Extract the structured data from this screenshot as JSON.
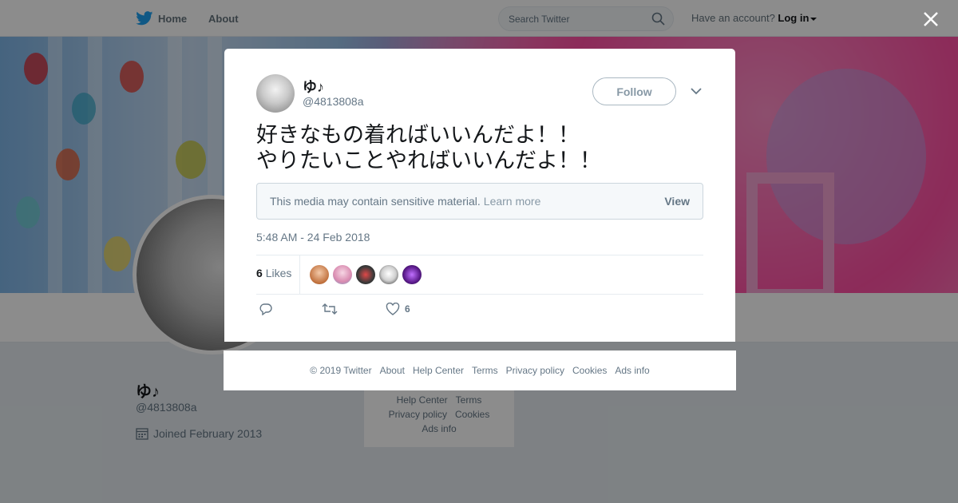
{
  "topbar": {
    "home_label": "Home",
    "about_label": "About",
    "search_placeholder": "Search Twitter",
    "account_prompt": "Have an account?",
    "login_label": "Log in"
  },
  "profile": {
    "name": "ゆ♪",
    "handle": "@4813808a",
    "joined": "Joined February 2013"
  },
  "side_footer": {
    "row1": [
      "Help Center",
      "Terms"
    ],
    "row2": [
      "Privacy policy",
      "Cookies"
    ],
    "row3": [
      "Ads info"
    ]
  },
  "tweet": {
    "author_name": "ゆ♪",
    "author_handle": "@4813808a",
    "follow_label": "Follow",
    "text_lines": [
      "好きなもの着ればいいんだよ！！",
      "やりたいことやればいいんだよ！！"
    ],
    "sensitive_message": "This media may contain sensitive material.",
    "learn_more_label": "Learn more",
    "view_label": "View",
    "timestamp": "5:48 AM - 24 Feb 2018",
    "likes_count": "6",
    "likes_label": "Likes",
    "like_action_count": "6"
  },
  "footer": {
    "copyright": "© 2019 Twitter",
    "links": [
      "About",
      "Help Center",
      "Terms",
      "Privacy policy",
      "Cookies",
      "Ads info"
    ]
  },
  "colors": {
    "twitter_blue": "#1da1f2",
    "text_secondary": "#657786",
    "border": "#e6ecf0"
  },
  "icons": [
    "twitter-bird-icon",
    "search-icon",
    "close-icon",
    "chevron-down-icon",
    "reply-icon",
    "retweet-icon",
    "heart-icon",
    "calendar-icon"
  ]
}
